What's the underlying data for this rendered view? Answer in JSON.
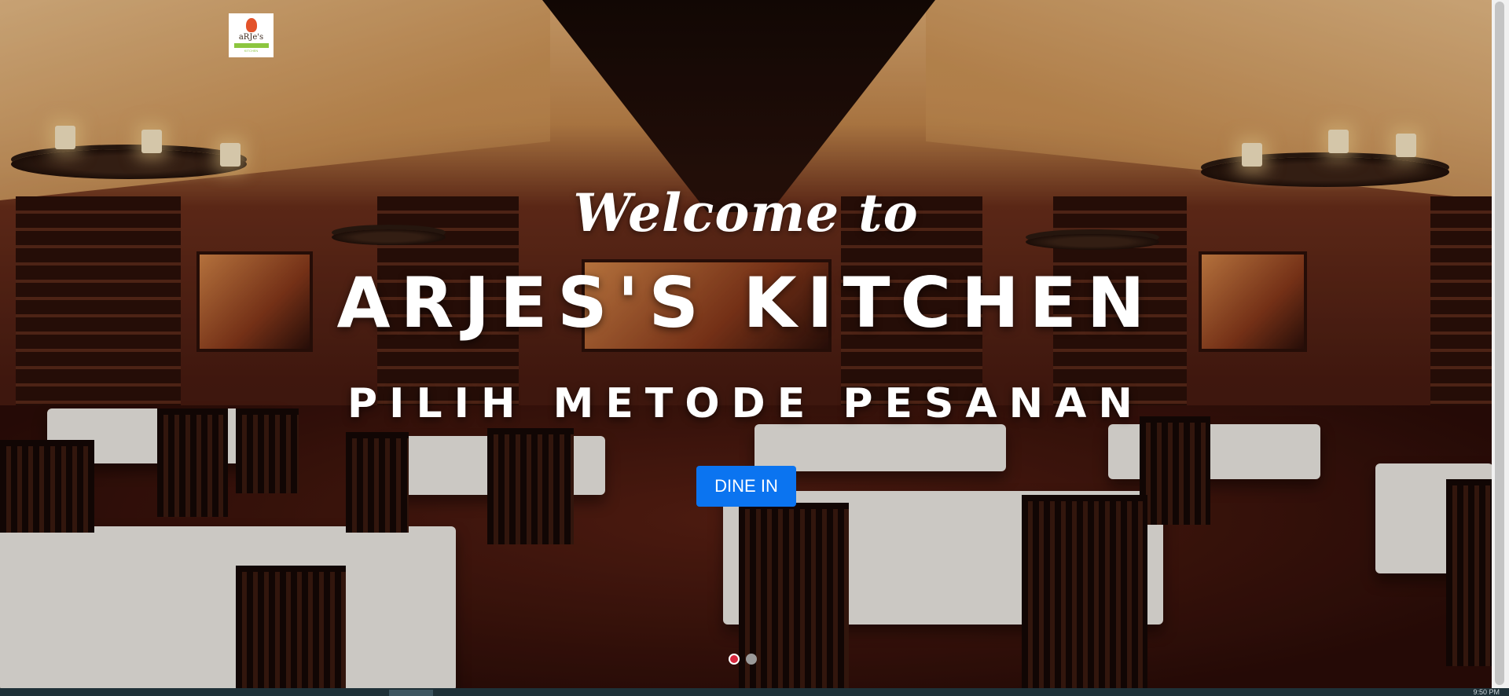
{
  "logo": {
    "text": "aRJe's",
    "sub": "KITCHEN"
  },
  "hero": {
    "welcome": "Welcome to",
    "brand": "ARJES'S KITCHEN",
    "subtitle": "PILIH METODE PESANAN",
    "button_label": "DINE IN"
  },
  "carousel": {
    "slides": 2,
    "active_index": 0
  },
  "taskbar": {
    "clock": "9:50 PM"
  },
  "colors": {
    "button": "#0b74f0",
    "active_dot": "#d7263d",
    "logo_green": "#8cc63f"
  }
}
